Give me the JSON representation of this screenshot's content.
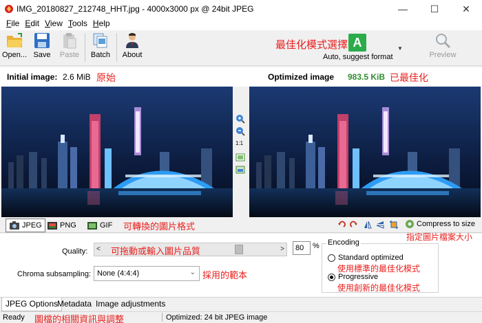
{
  "window": {
    "title": "IMG_20180827_212748_HHT.jpg - 4000x3000 px @ 24bit JPEG",
    "minimize_glyph": "—",
    "maximize_glyph": "☐",
    "close_glyph": "✕"
  },
  "menu": {
    "items": [
      {
        "label": "File",
        "ul": "F",
        "rest": "ile"
      },
      {
        "label": "Edit",
        "ul": "E",
        "rest": "dit"
      },
      {
        "label": "View",
        "ul": "V",
        "rest": "iew"
      },
      {
        "label": "Tools",
        "ul": "T",
        "rest": "ools"
      },
      {
        "label": "Help",
        "ul": "H",
        "rest": "elp"
      }
    ]
  },
  "toolbar": {
    "open_label": "Open...",
    "save_label": "Save",
    "paste_label": "Paste",
    "batch_label": "Batch",
    "about_label": "About",
    "format_note": "最佳化模式選擇",
    "format_badge": "A",
    "format_label": "Auto, suggest format",
    "preview_label": "Preview"
  },
  "info": {
    "initial_label": "Initial image:",
    "initial_size": "2.6 MiB",
    "initial_note": "原始",
    "optimized_label": "Optimized image",
    "optimized_size": "983.5 KiB",
    "optimized_note": "已最佳化",
    "optimized_color": "#2e8b2e"
  },
  "zoom": {
    "actual_size_label": "1:1"
  },
  "formats": {
    "items": [
      "JPEG",
      "PNG",
      "GIF"
    ],
    "note": "可轉換的圖片格式",
    "compress_label": "Compress to size",
    "compress_note": "指定圖片檔案大小"
  },
  "options": {
    "quality_label": "Quality:",
    "quality_note": "可拖動或輸入圖片品質",
    "quality_value": "80",
    "quality_fraction": 0.8,
    "pct_label": "%",
    "chroma_label": "Chroma subsampling:",
    "chroma_value": "None (4:4:4)",
    "chroma_note": "採用的範本",
    "encoding_title": "Encoding",
    "standard_label": "Standard optimized",
    "standard_note": "使用標準的最佳化模式",
    "progressive_label": "Progressive",
    "progressive_note": "使用創新的最佳化模式"
  },
  "tabs": {
    "items": [
      "JPEG Options",
      "Metadata",
      "Image adjustments"
    ]
  },
  "status": {
    "left": "Ready",
    "left_note": "圖檔的相關資訊與調整",
    "right": "Optimized: 24 bit JPEG image"
  },
  "colors": {
    "annotation_red": "#e8211f",
    "badge_green": "#2cab4a"
  }
}
